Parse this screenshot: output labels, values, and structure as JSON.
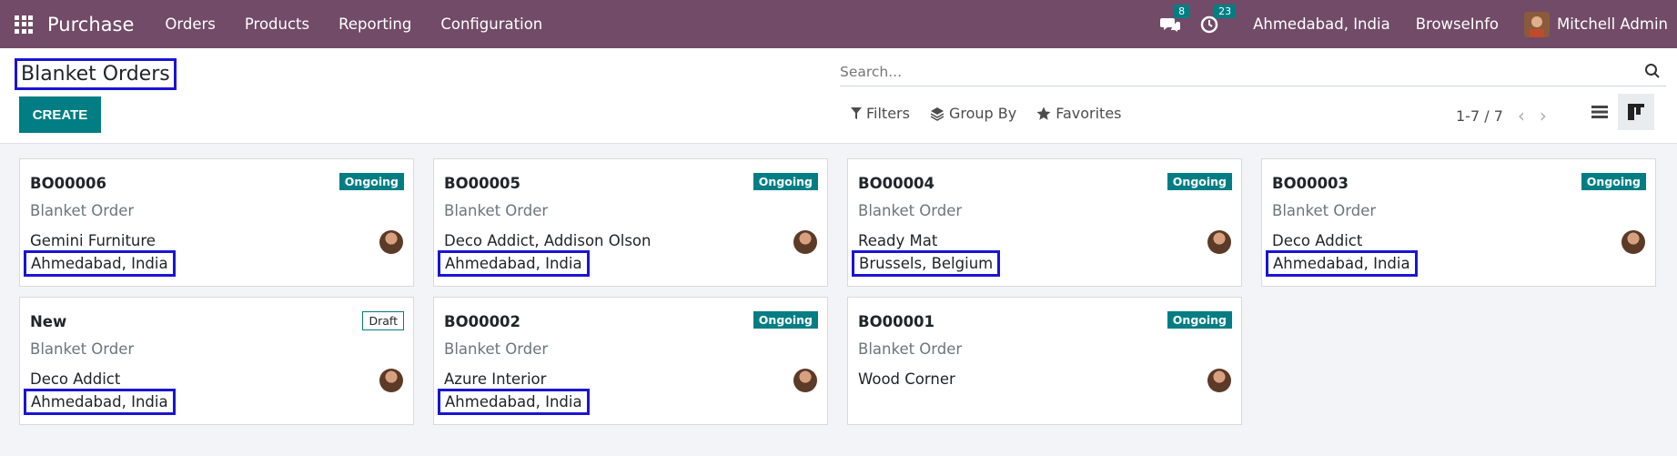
{
  "navbar": {
    "app_name": "Purchase",
    "menu": [
      "Orders",
      "Products",
      "Reporting",
      "Configuration"
    ],
    "messages_count": "8",
    "activities_count": "23",
    "company_location": "Ahmedabad, India",
    "company_name": "BrowseInfo",
    "user_name": "Mitchell Admin"
  },
  "control_panel": {
    "title": "Blanket Orders",
    "create_label": "CREATE",
    "search_placeholder": "Search...",
    "filters_label": "Filters",
    "groupby_label": "Group By",
    "favorites_label": "Favorites",
    "pager_text": "1-7 / 7"
  },
  "cards": [
    {
      "ref": "BO00006",
      "status": "Ongoing",
      "type": "Blanket Order",
      "partner": "Gemini Furniture",
      "location": "Ahmedabad, India"
    },
    {
      "ref": "BO00005",
      "status": "Ongoing",
      "type": "Blanket Order",
      "partner": "Deco Addict, Addison Olson",
      "location": "Ahmedabad, India"
    },
    {
      "ref": "BO00004",
      "status": "Ongoing",
      "type": "Blanket Order",
      "partner": "Ready Mat",
      "location": "Brussels, Belgium"
    },
    {
      "ref": "BO00003",
      "status": "Ongoing",
      "type": "Blanket Order",
      "partner": "Deco Addict",
      "location": "Ahmedabad, India"
    },
    {
      "ref": "New",
      "status": "Draft",
      "type": "Blanket Order",
      "partner": "Deco Addict",
      "location": "Ahmedabad, India"
    },
    {
      "ref": "BO00002",
      "status": "Ongoing",
      "type": "Blanket Order",
      "partner": "Azure Interior",
      "location": "Ahmedabad, India"
    },
    {
      "ref": "BO00001",
      "status": "Ongoing",
      "type": "Blanket Order",
      "partner": "Wood Corner",
      "location": ""
    }
  ],
  "colors": {
    "navbar_bg": "#714b67",
    "primary": "#017e84",
    "highlight_border": "#1a14d4"
  }
}
